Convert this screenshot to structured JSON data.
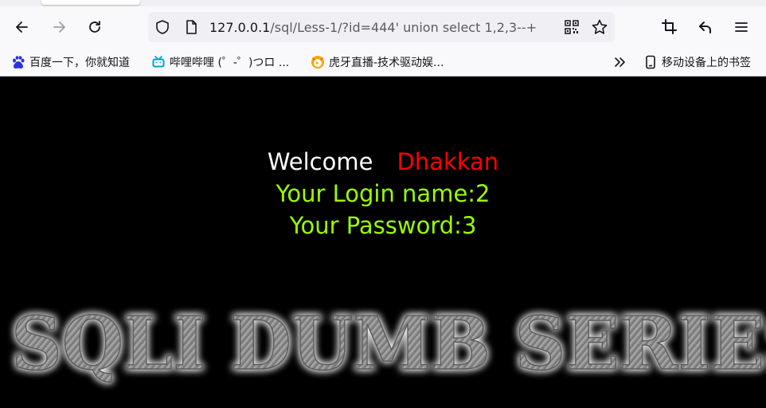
{
  "browser": {
    "url_host": "127.0.0.1",
    "url_path": "/sql/Less-1/?id=444' union select 1,2,3--+",
    "bookmarks": [
      {
        "label": "百度一下，你就知道",
        "icon": "baidu-paw-icon",
        "color": "#2932e1"
      },
      {
        "label": "哔哩哔哩 (゜-゜)つロ ...",
        "icon": "bilibili-tv-icon",
        "color": "#00a1d6"
      },
      {
        "label": "虎牙直播-技术驱动娱...",
        "icon": "huya-icon",
        "color": "#ffa200"
      }
    ],
    "mobile_bookmarks_label": "移动设备上的书签"
  },
  "page": {
    "welcome": "Welcome",
    "name": "Dhakkan",
    "login_line": "Your Login name:2",
    "password_line": "Your Password:3",
    "banner_text": "SQLI DUMB SERIES",
    "colors": {
      "background": "#000000",
      "welcome": "#ffffff",
      "name": "#ff0000",
      "info": "#99ff00"
    }
  }
}
